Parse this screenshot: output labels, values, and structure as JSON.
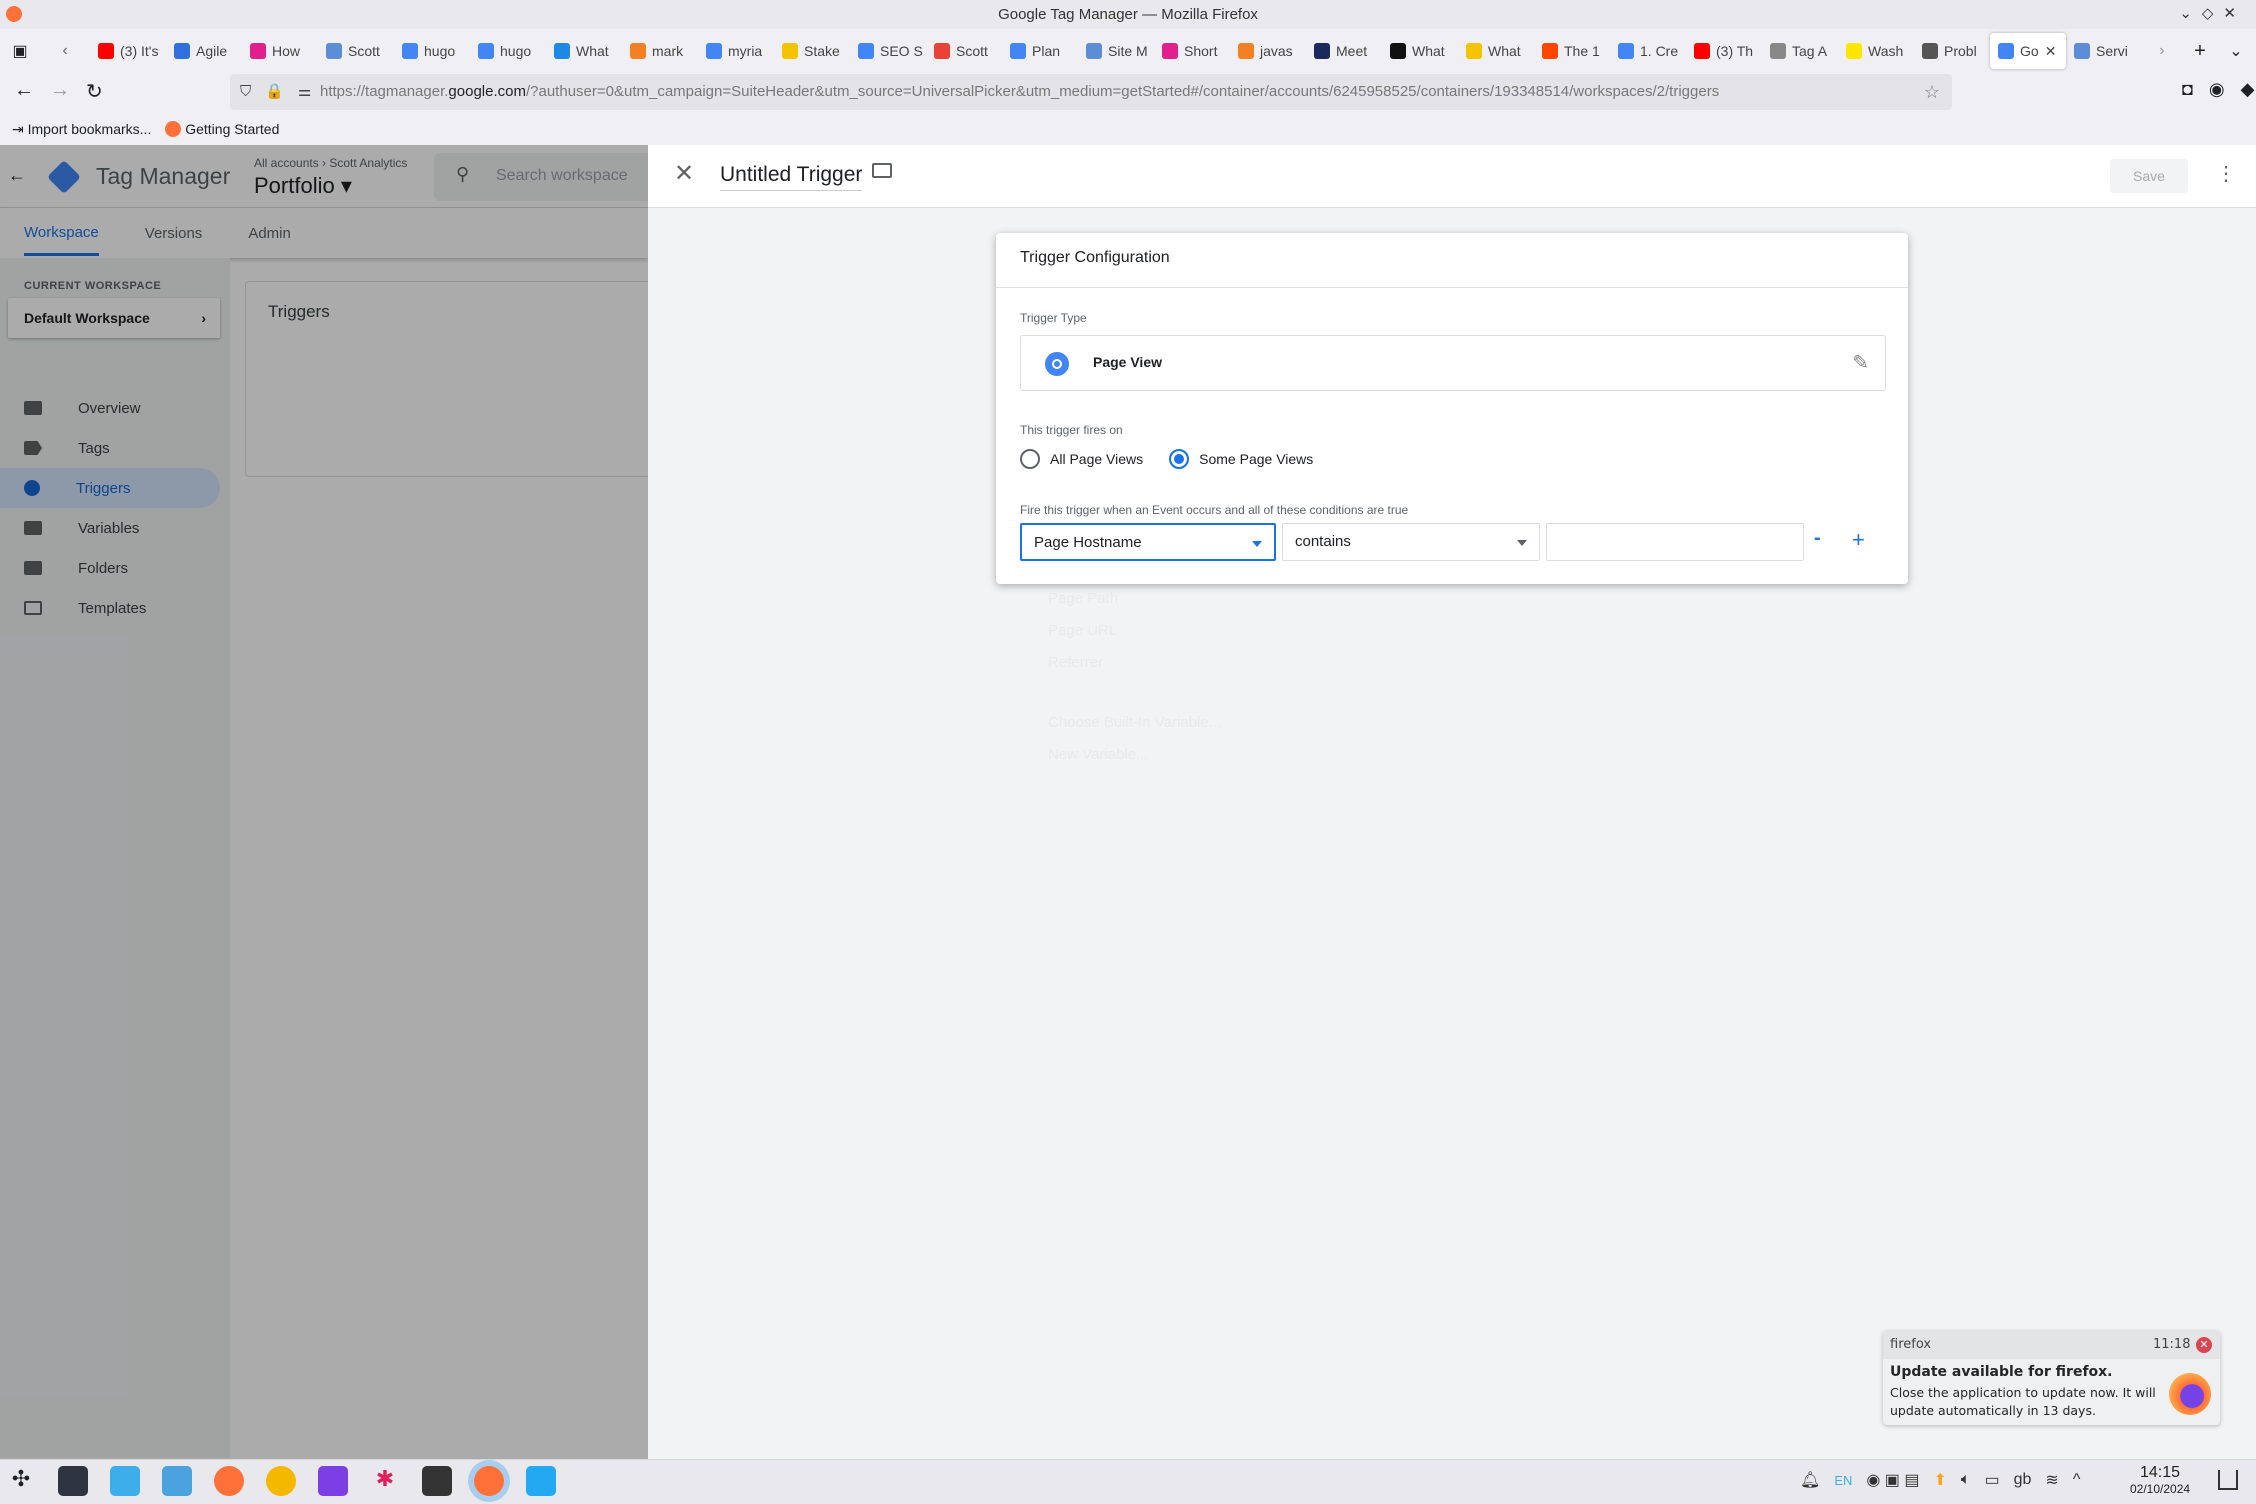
{
  "window": {
    "title": "Google Tag Manager — Mozilla Firefox"
  },
  "browser": {
    "tabs": [
      {
        "label": "(3) It's",
        "color": "#ff0000"
      },
      {
        "label": "Agile",
        "color": "#2f6fde"
      },
      {
        "label": "How",
        "color": "#e0218a"
      },
      {
        "label": "Scott",
        "color": "#5b8ed6"
      },
      {
        "label": "hugo",
        "color": "#4285f4"
      },
      {
        "label": "hugo",
        "color": "#4285f4"
      },
      {
        "label": "What",
        "color": "#1e88e5"
      },
      {
        "label": "mark",
        "color": "#f48024"
      },
      {
        "label": "myria",
        "color": "#4285f4"
      },
      {
        "label": "Stake",
        "color": "#f5c400"
      },
      {
        "label": "SEO S",
        "color": "#4285f4"
      },
      {
        "label": "Scott",
        "color": "#ea4335"
      },
      {
        "label": "Plan",
        "color": "#4285f4"
      },
      {
        "label": "Site M",
        "color": "#5b8ed6"
      },
      {
        "label": "Short",
        "color": "#e0218a"
      },
      {
        "label": "javas",
        "color": "#f48024"
      },
      {
        "label": "Meet",
        "color": "#1b2a5a"
      },
      {
        "label": "What",
        "color": "#111111"
      },
      {
        "label": "What",
        "color": "#f5c400"
      },
      {
        "label": "The 1",
        "color": "#ff4500"
      },
      {
        "label": "1. Cre",
        "color": "#4285f4"
      },
      {
        "label": "(3) Th",
        "color": "#ff0000"
      },
      {
        "label": "Tag A",
        "color": "#888888"
      },
      {
        "label": "Wash",
        "color": "#ffe600"
      },
      {
        "label": "Probl",
        "color": "#555555"
      },
      {
        "label": "Go",
        "color": "#4285f4",
        "active": true
      },
      {
        "label": "Servi",
        "color": "#5b8ed6"
      }
    ],
    "url_prefix": "https://tagmanager.",
    "url_domain": "google.com",
    "url_rest": "/?authuser=0&utm_campaign=SuiteHeader&utm_source=UniversalPicker&utm_medium=getStarted#/container/accounts/6245958525/containers/193348514/workspaces/2/triggers",
    "bookmarks": [
      "Import bookmarks...",
      "Getting Started"
    ]
  },
  "gtm": {
    "product": "Tag Manager",
    "breadcrumb": {
      "accounts": "All accounts",
      "account": "Scott Analytics"
    },
    "container": "Portfolio",
    "search_placeholder": "Search workspace",
    "tabs": [
      "Workspace",
      "Versions",
      "Admin"
    ],
    "current_workspace_label": "CURRENT WORKSPACE",
    "workspace": "Default Workspace",
    "nav": [
      "Overview",
      "Tags",
      "Triggers",
      "Variables",
      "Folders",
      "Templates"
    ],
    "selected_nav": "Triggers",
    "section_title": "Triggers"
  },
  "trigger": {
    "name": "Untitled Trigger",
    "save_label": "Save",
    "card_title": "Trigger Configuration",
    "type_label": "Trigger Type",
    "type": "Page View",
    "fires_on_label": "This trigger fires on",
    "options": [
      "All Page Views",
      "Some Page Views"
    ],
    "selected_option": "Some Page Views",
    "conditions_label": "Fire this trigger when an Event occurs and all of these conditions are true",
    "condition": {
      "variable": "Page Hostname",
      "operator": "contains",
      "value": ""
    },
    "remove_label": "-",
    "add_label": "+",
    "ghost_menu": [
      "Page Path",
      "Page URL",
      "Referrer",
      "Choose Built-In Variable...",
      "New Variable..."
    ],
    "accent": "#1a73e8"
  },
  "notification": {
    "app": "firefox",
    "time": "11:18",
    "title": "Update available for firefox.",
    "body": "Close the application to update now. It will update automatically in 13 days."
  },
  "taskbar": {
    "lang": "EN",
    "kb": "gb",
    "time": "14:15",
    "date": "02/10/2024"
  }
}
